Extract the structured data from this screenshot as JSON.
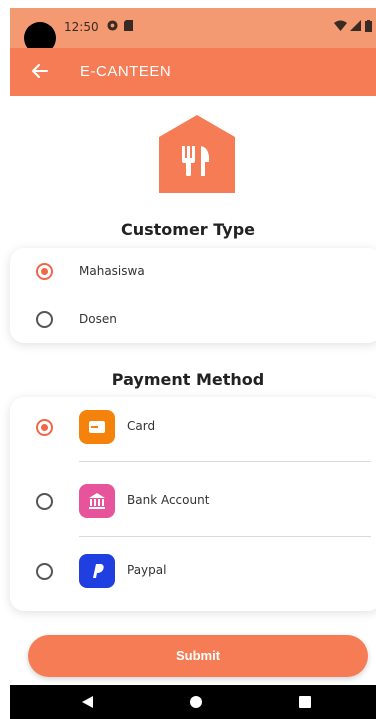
{
  "status_bar": {
    "time": "12:50",
    "icons": [
      "settings-icon",
      "sim-card-icon",
      "wifi-icon",
      "signal-icon",
      "battery-icon"
    ],
    "background_color": "#f39a72"
  },
  "app_bar": {
    "title": "E-CANTEEN",
    "back_icon": "arrow-left-icon",
    "background_color": "#f57c55"
  },
  "logo": {
    "icon": "restaurant-icon",
    "color": "#f57c55"
  },
  "customer_type": {
    "title": "Customer Type",
    "options": [
      {
        "label": "Mahasiswa",
        "selected": true
      },
      {
        "label": "Dosen",
        "selected": false
      }
    ]
  },
  "payment_method": {
    "title": "Payment Method",
    "options": [
      {
        "label": "Card",
        "icon": "card-icon",
        "icon_color": "#f4820b",
        "selected": true
      },
      {
        "label": "Bank Account",
        "icon": "bank-icon",
        "icon_color": "#e7549b",
        "selected": false
      },
      {
        "label": "Paypal",
        "icon": "paypal-icon",
        "icon_color": "#1f3fe0",
        "selected": false
      }
    ]
  },
  "submit": {
    "label": "Submit",
    "background_color": "#f57c55"
  },
  "nav_bar": {
    "icons": [
      "nav-back-icon",
      "nav-home-icon",
      "nav-recents-icon"
    ]
  },
  "accent_color": "#f0674a"
}
